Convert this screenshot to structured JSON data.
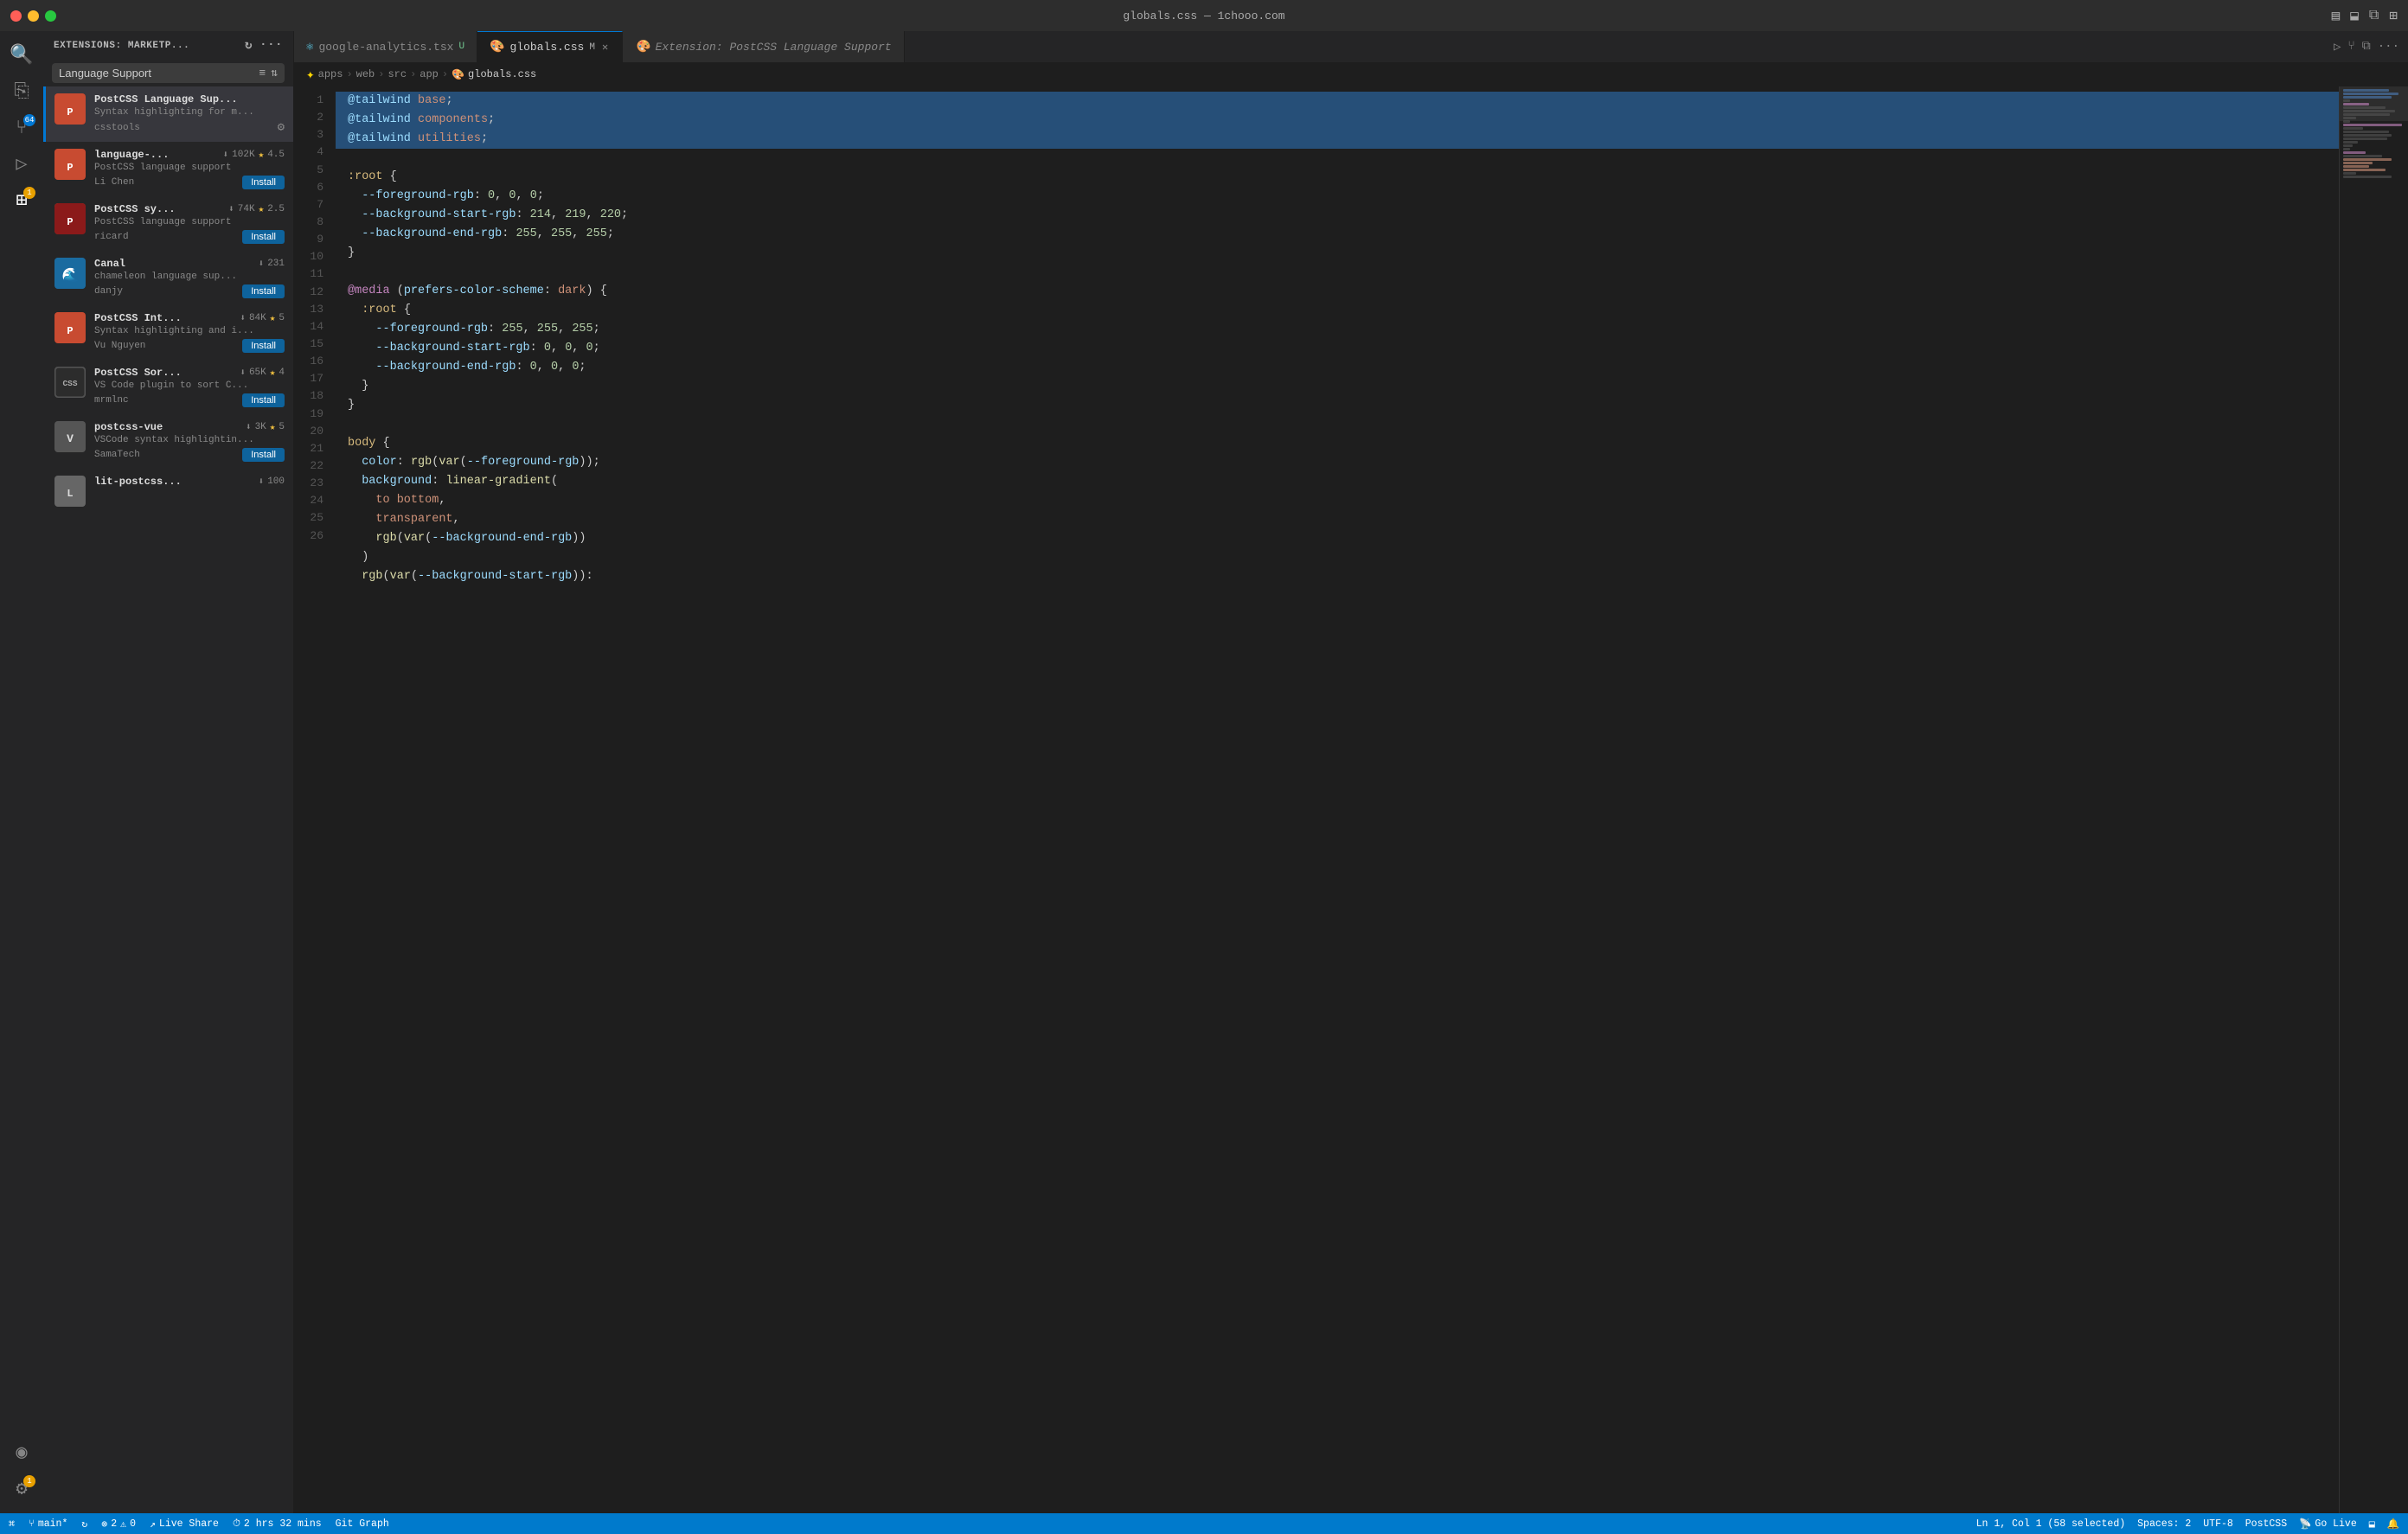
{
  "titlebar": {
    "title": "globals.css — 1chooo.com",
    "dots": [
      "red",
      "yellow",
      "green"
    ]
  },
  "sidebar": {
    "header": "EXTENSIONS: MARKETP...",
    "search_placeholder": "Language Support",
    "extensions": [
      {
        "id": "postcss-lang-sup",
        "name": "PostCSS Language Sup...",
        "desc": "Syntax highlighting for m...",
        "author": "csstools",
        "stats": null,
        "rating": null,
        "action": "gear",
        "active": true
      },
      {
        "id": "language-postcss",
        "name": "language-...",
        "desc": "PostCSS language support",
        "author": "Li Chen",
        "downloads": "102K",
        "rating": "4.5",
        "action": "install"
      },
      {
        "id": "postcss-syntax",
        "name": "PostCSS sy...",
        "desc": "PostCSS language support",
        "author": "ricard",
        "downloads": "74K",
        "rating": "2.5",
        "action": "install"
      },
      {
        "id": "canal",
        "name": "Canal",
        "desc": "chameleon language sup...",
        "author": "danjy",
        "downloads": "231",
        "rating": null,
        "action": "install"
      },
      {
        "id": "postcss-int",
        "name": "PostCSS Int...",
        "desc": "Syntax highlighting and i...",
        "author": "Vu Nguyen",
        "downloads": "84K",
        "rating": "5",
        "action": "install"
      },
      {
        "id": "postcss-sort",
        "name": "PostCSS Sor...",
        "desc": "VS Code plugin to sort C...",
        "author": "mrmlnc",
        "downloads": "65K",
        "rating": "4",
        "action": "install"
      },
      {
        "id": "postcss-vue",
        "name": "postcss-vue",
        "desc": "VSCode syntax highlightin...",
        "author": "SamaTech",
        "downloads": "3K",
        "rating": "5",
        "action": "install"
      },
      {
        "id": "lit-postcss",
        "name": "lit-postcss...",
        "desc": "",
        "author": "",
        "downloads": "100",
        "rating": null,
        "action": "install"
      }
    ]
  },
  "tabs": [
    {
      "id": "google-analytics",
      "label": "google-analytics.tsx",
      "icon": "⚛",
      "modified": "U",
      "active": false
    },
    {
      "id": "globals-css",
      "label": "globals.css",
      "icon": "🎨",
      "modified": "M",
      "active": true
    },
    {
      "id": "extension-postcss",
      "label": "Extension: PostCSS Language Support",
      "icon": "",
      "modified": "",
      "active": false,
      "preview": true
    }
  ],
  "breadcrumb": [
    "apps",
    "web",
    "src",
    "app",
    "globals.css"
  ],
  "code": {
    "lines": [
      {
        "n": 1,
        "text": "@tailwind base;",
        "selected": true
      },
      {
        "n": 2,
        "text": "@tailwind components;",
        "selected": true
      },
      {
        "n": 3,
        "text": "@tailwind utilities;",
        "selected": true
      },
      {
        "n": 4,
        "text": ""
      },
      {
        "n": 5,
        "text": ":root {"
      },
      {
        "n": 6,
        "text": "  --foreground-rgb: 0, 0, 0;"
      },
      {
        "n": 7,
        "text": "  --background-start-rgb: 214, 219, 220;"
      },
      {
        "n": 8,
        "text": "  --background-end-rgb: 255, 255, 255;"
      },
      {
        "n": 9,
        "text": "}"
      },
      {
        "n": 10,
        "text": ""
      },
      {
        "n": 11,
        "text": "@media (prefers-color-scheme: dark) {"
      },
      {
        "n": 12,
        "text": "  :root {"
      },
      {
        "n": 13,
        "text": "    --foreground-rgb: 255, 255, 255;"
      },
      {
        "n": 14,
        "text": "    --background-start-rgb: 0, 0, 0;"
      },
      {
        "n": 15,
        "text": "    --background-end-rgb: 0, 0, 0;"
      },
      {
        "n": 16,
        "text": "  }"
      },
      {
        "n": 17,
        "text": "}"
      },
      {
        "n": 18,
        "text": ""
      },
      {
        "n": 19,
        "text": "body {"
      },
      {
        "n": 20,
        "text": "  color: rgb(var(--foreground-rgb));"
      },
      {
        "n": 21,
        "text": "  background: linear-gradient("
      },
      {
        "n": 22,
        "text": "    to bottom,"
      },
      {
        "n": 23,
        "text": "    transparent,"
      },
      {
        "n": 24,
        "text": "    rgb(var(--background-end-rgb))"
      },
      {
        "n": 25,
        "text": "  )"
      },
      {
        "n": 26,
        "text": "  rgb(var(--background-start-rgb)):"
      }
    ]
  },
  "status": {
    "branch": "main*",
    "sync": "",
    "errors": "2",
    "warnings": "0",
    "live_share": "Live Share",
    "time": "2 hrs 32 mins",
    "git_graph": "Git Graph",
    "ln_col": "Ln 1, Col 1 (58 selected)",
    "spaces": "Spaces: 2",
    "encoding": "UTF-8",
    "language": "PostCSS",
    "go_live": "Go Live"
  }
}
